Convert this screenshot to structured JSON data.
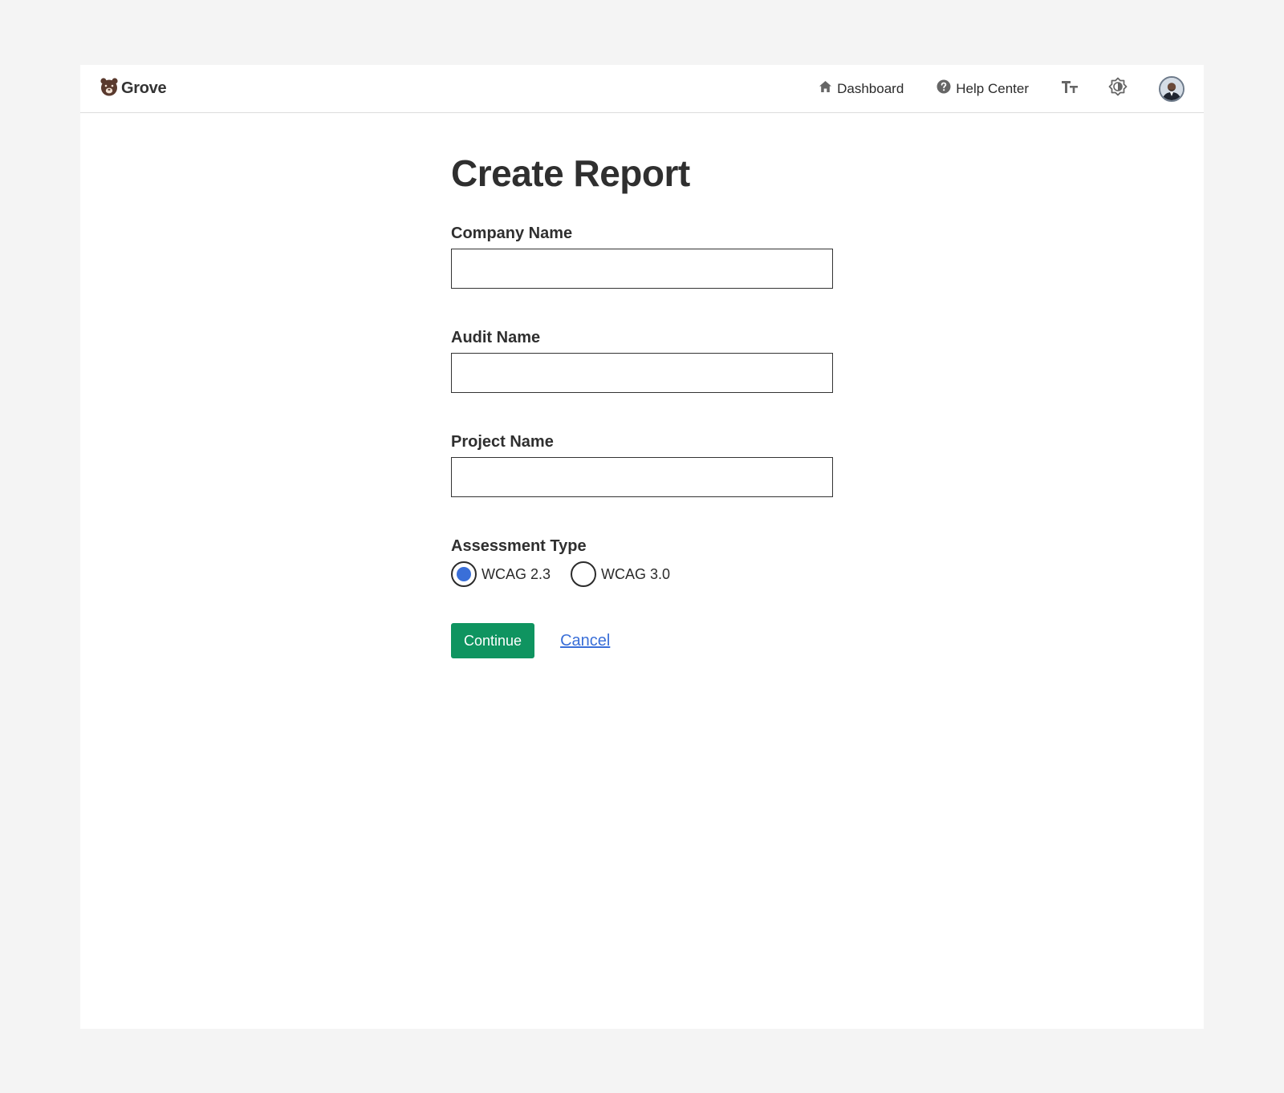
{
  "app": {
    "brand": "Grove",
    "brand_color": "#5a3a2e",
    "accent_color": "#0f9460",
    "link_color": "#3a6fd8"
  },
  "header": {
    "nav": [
      {
        "label": "Dashboard",
        "icon": "home-icon"
      },
      {
        "label": "Help Center",
        "icon": "help-circle-icon"
      }
    ],
    "text_size_icon": "text-size-icon",
    "contrast_icon": "contrast-icon",
    "avatar_icon": "user-avatar"
  },
  "form": {
    "title": "Create Report",
    "fields": [
      {
        "label": "Company Name",
        "value": "",
        "placeholder": ""
      },
      {
        "label": "Audit Name",
        "value": "",
        "placeholder": ""
      },
      {
        "label": "Project Name",
        "value": "",
        "placeholder": ""
      }
    ],
    "assessment": {
      "label": "Assessment Type",
      "options": [
        {
          "label": "WCAG 2.3",
          "selected": true
        },
        {
          "label": "WCAG 3.0",
          "selected": false
        }
      ]
    },
    "continue_label": "Continue",
    "cancel_label": "Cancel"
  }
}
